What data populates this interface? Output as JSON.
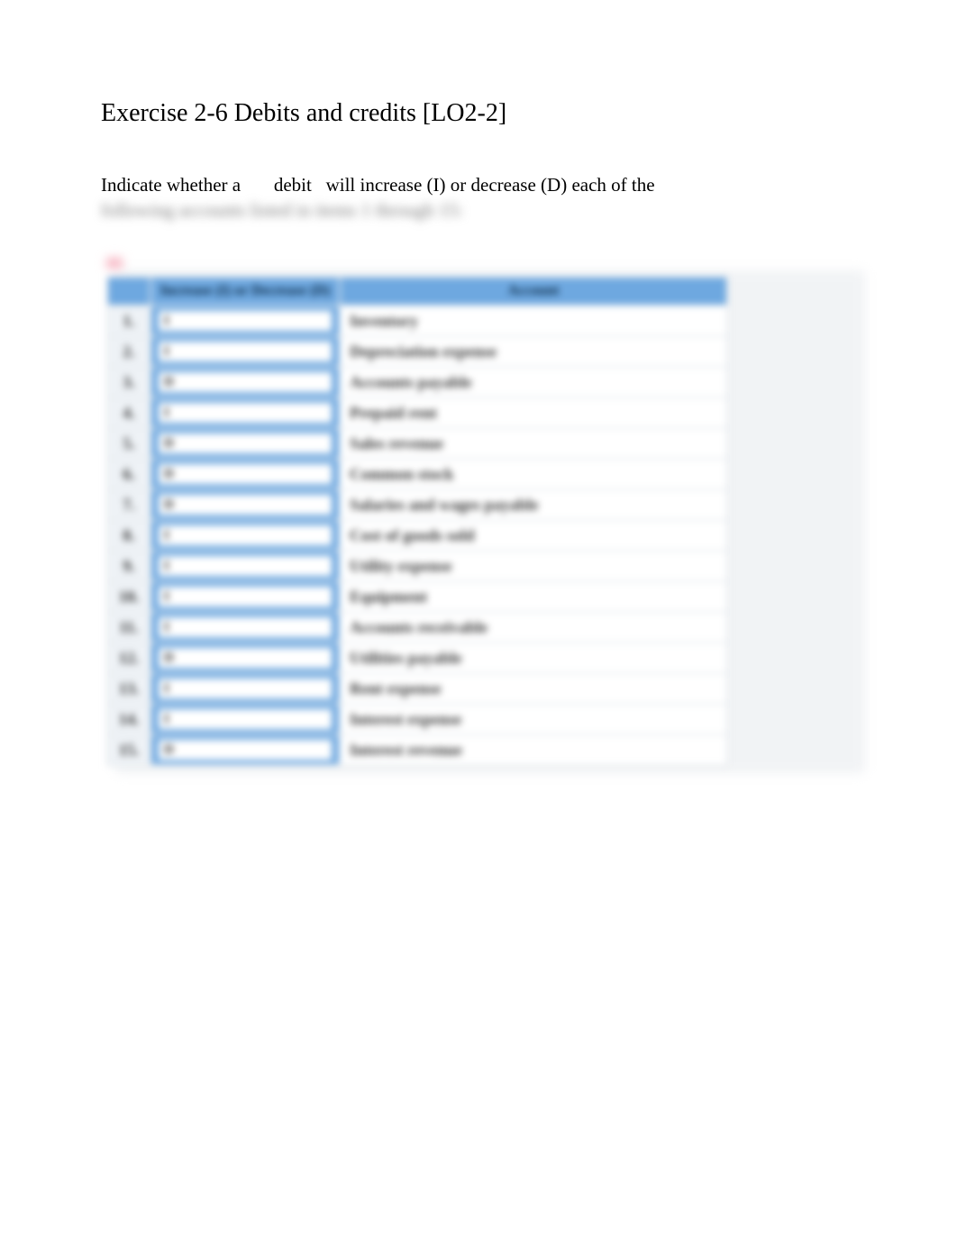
{
  "title": "Exercise 2-6 Debits and credits [LO2-2]",
  "instructions": {
    "part1": "Indicate whether a ",
    "gap1": "      ",
    "part2": "debit",
    "gap2": "   ",
    "part3": "will increase (I) or decrease (D) each of the",
    "line2": "following accounts listed in items 1 through 15:"
  },
  "table": {
    "headers": {
      "col_id": "Increase (I) or\nDecrease (D)",
      "col_acct": "Account"
    },
    "rows": [
      {
        "num": "1.",
        "id": "I",
        "account": "Inventory"
      },
      {
        "num": "2.",
        "id": "I",
        "account": "Depreciation expense"
      },
      {
        "num": "3.",
        "id": "D",
        "account": "Accounts payable"
      },
      {
        "num": "4.",
        "id": "I",
        "account": "Prepaid rent"
      },
      {
        "num": "5.",
        "id": "D",
        "account": "Sales revenue"
      },
      {
        "num": "6.",
        "id": "D",
        "account": "Common stock"
      },
      {
        "num": "7.",
        "id": "D",
        "account": "Salaries and wages payable"
      },
      {
        "num": "8.",
        "id": "I",
        "account": "Cost of goods sold"
      },
      {
        "num": "9.",
        "id": "I",
        "account": "Utility expense"
      },
      {
        "num": "10.",
        "id": "I",
        "account": "Equipment"
      },
      {
        "num": "11.",
        "id": "I",
        "account": "Accounts receivable"
      },
      {
        "num": "12.",
        "id": "D",
        "account": "Utilities payable"
      },
      {
        "num": "13.",
        "id": "I",
        "account": "Rent expense"
      },
      {
        "num": "14.",
        "id": "I",
        "account": "Interest expense"
      },
      {
        "num": "15.",
        "id": "D",
        "account": "Interest revenue"
      }
    ]
  }
}
